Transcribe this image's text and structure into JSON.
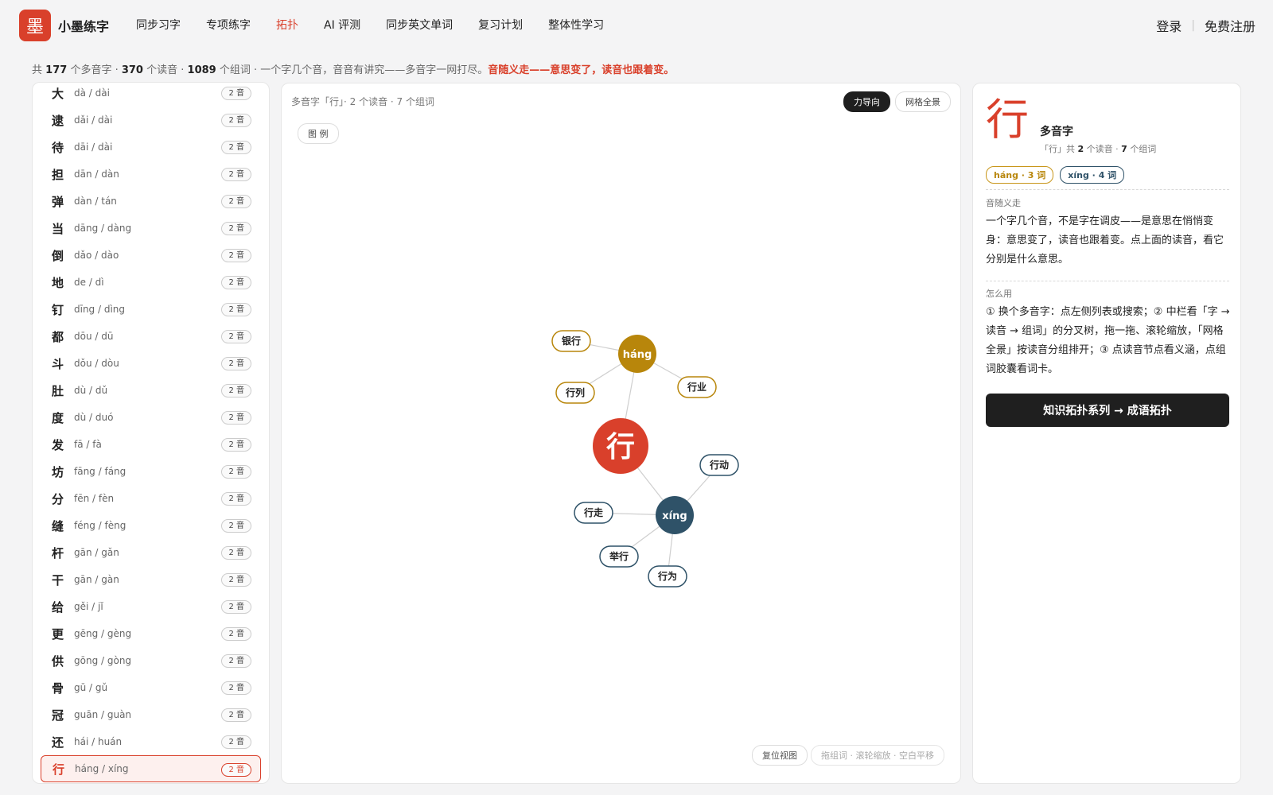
{
  "header": {
    "logo_glyph": "墨",
    "brand": "小墨练字",
    "nav": [
      {
        "label": "同步习字",
        "active": false
      },
      {
        "label": "专项练字",
        "active": false
      },
      {
        "label": "拓扑",
        "active": true
      },
      {
        "label": "AI 评测",
        "active": false
      },
      {
        "label": "同步英文单词",
        "active": false
      },
      {
        "label": "复习计划",
        "active": false
      },
      {
        "label": "整体性学习",
        "active": false
      }
    ],
    "login": "登录",
    "separator": "|",
    "register": "免费注册"
  },
  "stats": {
    "prefix": "共",
    "char_count": "177",
    "char_unit": "个多音字 ·",
    "reading_count": "370",
    "reading_unit": "个读音 ·",
    "word_count": "1089",
    "word_unit": "个组词 · 一个字几个音，音音有讲究——多音字一网打尽。",
    "highlight": "音随义走——意思变了，读音也跟着变。"
  },
  "list": [
    {
      "char": "大",
      "pinyin": "dà / dài",
      "badge": "2 音"
    },
    {
      "char": "逮",
      "pinyin": "dǎi / dài",
      "badge": "2 音"
    },
    {
      "char": "待",
      "pinyin": "dāi / dài",
      "badge": "2 音"
    },
    {
      "char": "担",
      "pinyin": "dān / dàn",
      "badge": "2 音"
    },
    {
      "char": "弹",
      "pinyin": "dàn / tán",
      "badge": "2 音"
    },
    {
      "char": "当",
      "pinyin": "dāng / dàng",
      "badge": "2 音"
    },
    {
      "char": "倒",
      "pinyin": "dǎo / dào",
      "badge": "2 音"
    },
    {
      "char": "地",
      "pinyin": "de / dì",
      "badge": "2 音"
    },
    {
      "char": "钉",
      "pinyin": "dīng / dìng",
      "badge": "2 音"
    },
    {
      "char": "都",
      "pinyin": "dōu / dū",
      "badge": "2 音"
    },
    {
      "char": "斗",
      "pinyin": "dǒu / dòu",
      "badge": "2 音"
    },
    {
      "char": "肚",
      "pinyin": "dù / dǔ",
      "badge": "2 音"
    },
    {
      "char": "度",
      "pinyin": "dù / duó",
      "badge": "2 音"
    },
    {
      "char": "发",
      "pinyin": "fā / fà",
      "badge": "2 音"
    },
    {
      "char": "坊",
      "pinyin": "fāng / fáng",
      "badge": "2 音"
    },
    {
      "char": "分",
      "pinyin": "fēn / fèn",
      "badge": "2 音"
    },
    {
      "char": "缝",
      "pinyin": "féng / fèng",
      "badge": "2 音"
    },
    {
      "char": "杆",
      "pinyin": "gān / gǎn",
      "badge": "2 音"
    },
    {
      "char": "干",
      "pinyin": "gān / gàn",
      "badge": "2 音"
    },
    {
      "char": "给",
      "pinyin": "gěi / jǐ",
      "badge": "2 音"
    },
    {
      "char": "更",
      "pinyin": "gēng / gèng",
      "badge": "2 音"
    },
    {
      "char": "供",
      "pinyin": "gōng / gòng",
      "badge": "2 音"
    },
    {
      "char": "骨",
      "pinyin": "gū / gǔ",
      "badge": "2 音"
    },
    {
      "char": "冠",
      "pinyin": "guān / guàn",
      "badge": "2 音"
    },
    {
      "char": "还",
      "pinyin": "hái / huán",
      "badge": "2 音"
    },
    {
      "char": "行",
      "pinyin": "háng / xíng",
      "badge": "2 音",
      "selected": true
    }
  ],
  "middle": {
    "heading": "多音字「行」· 2 个读音 · 7 个组词",
    "mode_force": "力导向",
    "mode_grid": "网格全景",
    "legend": "图 例",
    "reset": "复位视图",
    "hint": "拖组词 · 滚轮缩放 · 空白平移"
  },
  "graph": {
    "center": "行",
    "colors": {
      "center": "#d9402b",
      "hang": "#b8860b",
      "xing": "#2f5268"
    },
    "readings": [
      {
        "id": "hang",
        "label": "háng",
        "words": [
          "银行",
          "行列",
          "行业"
        ]
      },
      {
        "id": "xing",
        "label": "xíng",
        "words": [
          "行动",
          "行走",
          "举行",
          "行为"
        ]
      }
    ]
  },
  "detail": {
    "char": "行",
    "title": "多音字",
    "sub_pre": "「行」共",
    "sub_readings": "2",
    "sub_mid": "个读音 ·",
    "sub_words": "7",
    "sub_post": "个组词",
    "chips": [
      {
        "label": "háng · 3 词",
        "kind": "hang"
      },
      {
        "label": "xíng · 4 词",
        "kind": "xing"
      }
    ],
    "section1_label": "音随义走",
    "section1_text": "一个字几个音，不是字在调皮——是意思在悄悄变身：意思变了，读音也跟着变。点上面的读音，看它分别是什么意思。",
    "section2_label": "怎么用",
    "section2_text": "① 换个多音字：点左侧列表或搜索；② 中栏看「字 → 读音 → 组词」的分叉树，拖一拖、滚轮缩放，「网格全景」按读音分组排开；③ 点读音节点看义涵，点组词胶囊看词卡。",
    "cta": "知识拓扑系列 → 成语拓扑"
  }
}
